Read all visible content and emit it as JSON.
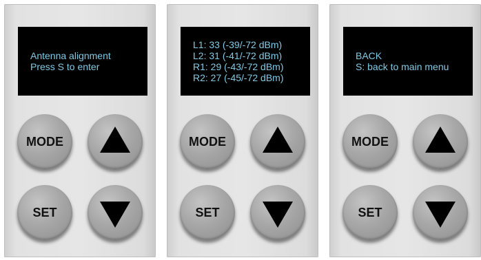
{
  "panels": [
    {
      "screen": {
        "lines": [
          "Antenna alignment",
          "Press S to enter"
        ]
      },
      "buttons": {
        "mode_label": "MODE",
        "set_label": "SET",
        "up_icon": "triangle-up-icon",
        "down_icon": "triangle-down-icon"
      }
    },
    {
      "screen": {
        "lines": [
          "L1: 33 (-39/-72 dBm)",
          "L2: 31 (-41/-72 dBm)",
          "R1: 29 (-43/-72 dBm)",
          "R2: 27 (-45/-72 dBm)"
        ]
      },
      "buttons": {
        "mode_label": "MODE",
        "set_label": "SET",
        "up_icon": "triangle-up-icon",
        "down_icon": "triangle-down-icon"
      }
    },
    {
      "screen": {
        "lines": [
          "BACK",
          "S: back to main menu"
        ]
      },
      "buttons": {
        "mode_label": "MODE",
        "set_label": "SET",
        "up_icon": "triangle-up-icon",
        "down_icon": "triangle-down-icon"
      }
    }
  ],
  "colors": {
    "screen_background": "#000000",
    "screen_text": "#7ecbe8",
    "panel_background": "#e4e4e4",
    "button_face": "#a7a7a7",
    "arrow": "#000000"
  }
}
